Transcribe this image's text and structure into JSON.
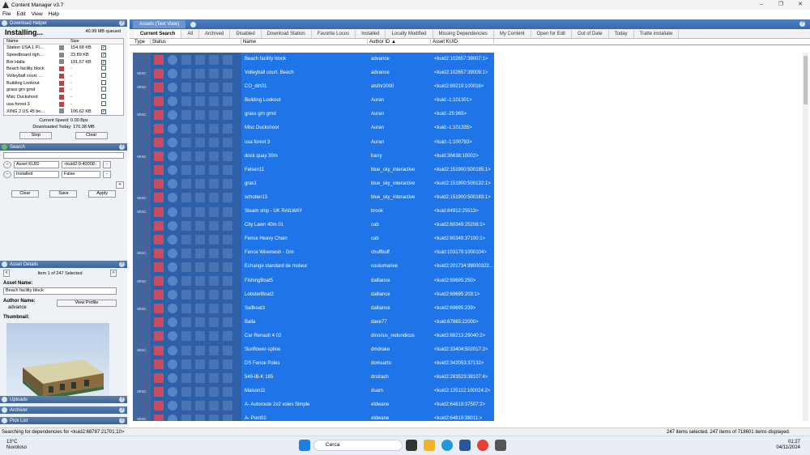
{
  "window": {
    "title": "Content Manager v3.7",
    "controls": [
      "–",
      "❐",
      "✕"
    ]
  },
  "menu": [
    "File",
    "Edit",
    "View",
    "Help"
  ],
  "download_helper": {
    "header": "Download Helper",
    "status": "Installing...",
    "queued": "40.99 MB queued",
    "columns": [
      "Name",
      "Size"
    ],
    "rows": [
      {
        "name": "Station USA 1 Pl...",
        "size": "154.68 KB",
        "checked": true
      },
      {
        "name": "Speedboard righ...",
        "size": "23.89 KB",
        "checked": true
      },
      {
        "name": "Bre Halla",
        "size": "191.57 KB",
        "checked": true
      },
      {
        "name": "Beach facility block",
        "size": "-",
        "checked": false
      },
      {
        "name": "Volleyball court. ...",
        "size": "-",
        "checked": false
      },
      {
        "name": "Building Lookout",
        "size": "-",
        "checked": false
      },
      {
        "name": "grass grn grnd",
        "size": "-",
        "checked": false
      },
      {
        "name": "Misc Duckshoot",
        "size": "-",
        "checked": false
      },
      {
        "name": "usa forest 3",
        "size": "-",
        "checked": false
      },
      {
        "name": "XING 2 US 45 bo...",
        "size": "106.62 KB",
        "checked": true
      },
      {
        "name": "Community Gro...",
        "size": "171.54 KB",
        "checked": true
      }
    ],
    "current_speed": "Current Speed: 0.00 Bps",
    "downloaded_today": "Downloaded Today: 170.38 MB",
    "stop": "Stop",
    "clear": "Clear"
  },
  "search": {
    "header": "Search",
    "field1": "Asset KUID",
    "value1": "<kuid2:9:40008::",
    "field2": "Installed",
    "value2": "False",
    "clear": "Clear",
    "save": "Save",
    "apply": "Apply"
  },
  "asset_details": {
    "header": "Asset Details",
    "pager": "Item 1 of 247 Selected",
    "asset_name_label": "Asset Name:",
    "asset_name": "Beach facility block",
    "author_label": "Author Name:",
    "author": "advance",
    "view_profile": "View Profile",
    "thumbnail_label": "Thumbnail:"
  },
  "bottom_sections": [
    "Uploads",
    "Archiver",
    "Pick List"
  ],
  "main": {
    "tab": "Assets (Text View)",
    "filters": [
      "Current Search",
      "All",
      "Archived",
      "Disabled",
      "Download Station",
      "Favorite Locos",
      "Installed",
      "Locally Modified",
      "Missing Dependencies",
      "My Content",
      "Open for Edit",
      "Out of Date",
      "Today",
      "Tratte installate"
    ],
    "columns": [
      "Type",
      "Status",
      "Name",
      "Author ID",
      "Asset KUID"
    ],
    "rows": [
      {
        "type": "",
        "name": "Beach facility block",
        "author": "advance",
        "kuid": "<kuid2:102657:39007:1>"
      },
      {
        "type": "MISC",
        "name": "Volleyball court. Beach",
        "author": "advance",
        "kuid": "<kuid2:102657:39009:1>"
      },
      {
        "type": "MISC",
        "name": "CO_dirt01",
        "author": "atsfnr3000",
        "kuid": "<kuid2:89219:100016>"
      },
      {
        "type": "",
        "name": "Building Lookout",
        "author": "Auran",
        "kuid": "<kuid:-1:101301>"
      },
      {
        "type": "MISC",
        "name": "grass grn grnd",
        "author": "Auran",
        "kuid": "<kuid:-25:965>"
      },
      {
        "type": "",
        "name": "Misc Duckshoot",
        "author": "Auran",
        "kuid": "<kuid:-1:101335>"
      },
      {
        "type": "",
        "name": "usa forest 3",
        "author": "Auran",
        "kuid": "<kuid:-1:100793>"
      },
      {
        "type": "MISC",
        "name": "dock quay 30m",
        "author": "barry",
        "kuid": "<kuid:36638:10002>"
      },
      {
        "type": "",
        "name": "Felsen11",
        "author": "blue_sky_interactive",
        "kuid": "<kuid2:151900:500195:1>"
      },
      {
        "type": "",
        "name": "gras1",
        "author": "blue_sky_interactive",
        "kuid": "<kuid2:151900:500132:1>"
      },
      {
        "type": "MISC",
        "name": "schotter13",
        "author": "blue_sky_interactive",
        "kuid": "<kuid2:151900:500183:1>"
      },
      {
        "type": "MISC",
        "name": "Steam ship - UK RAILWAY",
        "author": "brook",
        "kuid": "<kuid:84912:25513>"
      },
      {
        "type": "",
        "name": "City Lawn 40m 01",
        "author": "cab",
        "kuid": "<kuid2:60349:25208:1>"
      },
      {
        "type": "",
        "name": "Fence Heavy Chain",
        "author": "cab",
        "kuid": "<kuid2:60349:37100:1>"
      },
      {
        "type": "MISC",
        "name": "Fence Wiremesh - Grn",
        "author": "chuffbuff",
        "kuid": "<kuid:103179:1000104>"
      },
      {
        "type": "",
        "name": "Echange standard de moteur",
        "author": "coutumariee",
        "kuid": "<kuid2:201734:99000322..."
      },
      {
        "type": "MISC",
        "name": "FishingBoat5",
        "author": "dalliance",
        "kuid": "<kuid2:69695:250>"
      },
      {
        "type": "",
        "name": "LobsterBoat2",
        "author": "dalliance",
        "kuid": "<kuid2:69695:203:1>"
      },
      {
        "type": "MISC",
        "name": "Sailboat3",
        "author": "dalliance",
        "kuid": "<kuid2:69695:239>"
      },
      {
        "type": "",
        "name": "Balla",
        "author": "dave77",
        "kuid": "<kuid:67865:22000>"
      },
      {
        "type": "",
        "name": "Car Renault 4 02",
        "author": "dinorius_redundicus",
        "kuid": "<kuid2:68213:29040:2>"
      },
      {
        "type": "MISC",
        "name": "Sunflower-spline",
        "author": "dmdrake",
        "kuid": "<kuid2:33404:502017:2>"
      },
      {
        "type": "",
        "name": "DS Fence Poles",
        "author": "domsarto",
        "kuid": "<kuid2:342053:37132>"
      },
      {
        "type": "",
        "name": "549-IB-K 165",
        "author": "drstrach",
        "kuid": "<kuid2:283523:38107:4>"
      },
      {
        "type": "MISC",
        "name": "Maison11",
        "author": "duam",
        "kuid": "<kuid2:135112:100024:2>"
      },
      {
        "type": "",
        "name": "A- Autoroute 2x2 voies Simple",
        "author": "eldwane",
        "kuid": "<kuid2:64819:37507:2>"
      },
      {
        "type": "MISC",
        "name": "A- Pont02",
        "author": "eldwane",
        "kuid": "<kuid2:64819:38011:>"
      }
    ]
  },
  "statusbar": {
    "left": "Searching for dependencies for <kuid2:68787:21701:10>",
    "right": "247 items selected. 247 items of 718601 items displayed."
  },
  "taskbar": {
    "temp": "13°C",
    "weather": "Nuvoloso",
    "search": "Cerca",
    "time": "01:27",
    "date": "04/11/2024"
  }
}
